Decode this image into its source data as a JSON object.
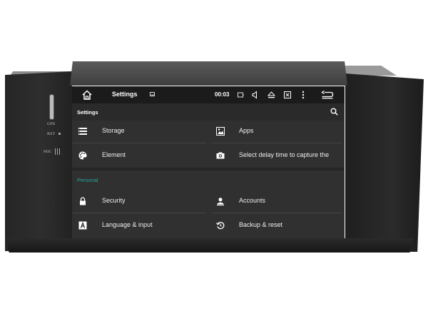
{
  "hardware": {
    "gps_label": "GPS",
    "rst_label": "RST",
    "mic_label": "MIC"
  },
  "statusbar": {
    "home_icon": "home-icon",
    "title": "Settings",
    "time": "00:03",
    "icons": [
      "image-icon",
      "battery-icon",
      "volume-icon",
      "eject-icon",
      "close-box-icon",
      "more-vert-icon",
      "back-icon"
    ]
  },
  "header": {
    "label": "Settings",
    "search_icon": "search-icon"
  },
  "device_items": [
    {
      "label": "Storage",
      "icon": "storage-icon"
    },
    {
      "label": "Apps",
      "icon": "apps-icon"
    },
    {
      "label": "Element",
      "icon": "palette-icon"
    },
    {
      "label": "Select delay time to capture the",
      "icon": "camera-icon"
    }
  ],
  "personal": {
    "heading": "Personal",
    "items": [
      {
        "label": "Security",
        "icon": "lock-icon"
      },
      {
        "label": "Accounts",
        "icon": "account-icon"
      },
      {
        "label": "Language & input",
        "icon": "keyboard-letter-icon"
      },
      {
        "label": "Backup & reset",
        "icon": "restore-icon"
      }
    ]
  },
  "colors": {
    "screen_bg": "#303030",
    "statusbar_bg": "#1b1b1b",
    "accent": "#26a69a",
    "text": "#ffffff"
  }
}
